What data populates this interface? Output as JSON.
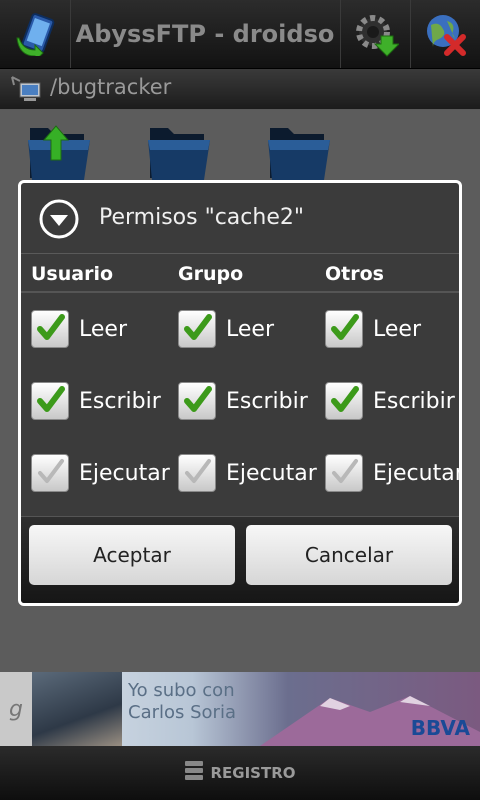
{
  "topbar": {
    "title": "AbyssFTP - droidso",
    "left_icon": "phone-sync-icon",
    "right_icons": [
      "gear-download-icon",
      "globe-disconnect-icon"
    ]
  },
  "pathbar": {
    "icon": "network-computer-icon",
    "path": "/bugtracker"
  },
  "files": {
    "items": [
      {
        "icon": "folder-up-icon"
      },
      {
        "icon": "folder-icon"
      },
      {
        "icon": "folder-icon"
      }
    ]
  },
  "dialog": {
    "icon": "chevron-down-circle-icon",
    "title": "Permisos \"cache2\"",
    "columns": [
      {
        "header": "Usuario",
        "leer": "Leer",
        "escribir": "Escribir",
        "ejecutar": "Ejecutar",
        "checked": {
          "leer": true,
          "escribir": true,
          "ejecutar": false
        }
      },
      {
        "header": "Grupo",
        "leer": "Leer",
        "escribir": "Escribir",
        "ejecutar": "Ejecutar",
        "checked": {
          "leer": true,
          "escribir": true,
          "ejecutar": false
        }
      },
      {
        "header": "Otros",
        "leer": "Leer",
        "escribir": "Escribir",
        "ejecutar": "Ejecutar",
        "checked": {
          "leer": true,
          "escribir": true,
          "ejecutar": false
        }
      }
    ],
    "accept_label": "Aceptar",
    "cancel_label": "Cancelar"
  },
  "ad": {
    "badge": "g",
    "line1": "Yo subo con",
    "line2": "Carlos Soria",
    "brand": "BBVA"
  },
  "bottombar": {
    "icon": "server-icon",
    "label": "REGISTRO"
  },
  "colors": {
    "check_green": "#3c9a1a",
    "check_gray": "#b0b0b0",
    "dialog_bg": "#3b3b3b",
    "accent_green": "#2f9e1e"
  }
}
